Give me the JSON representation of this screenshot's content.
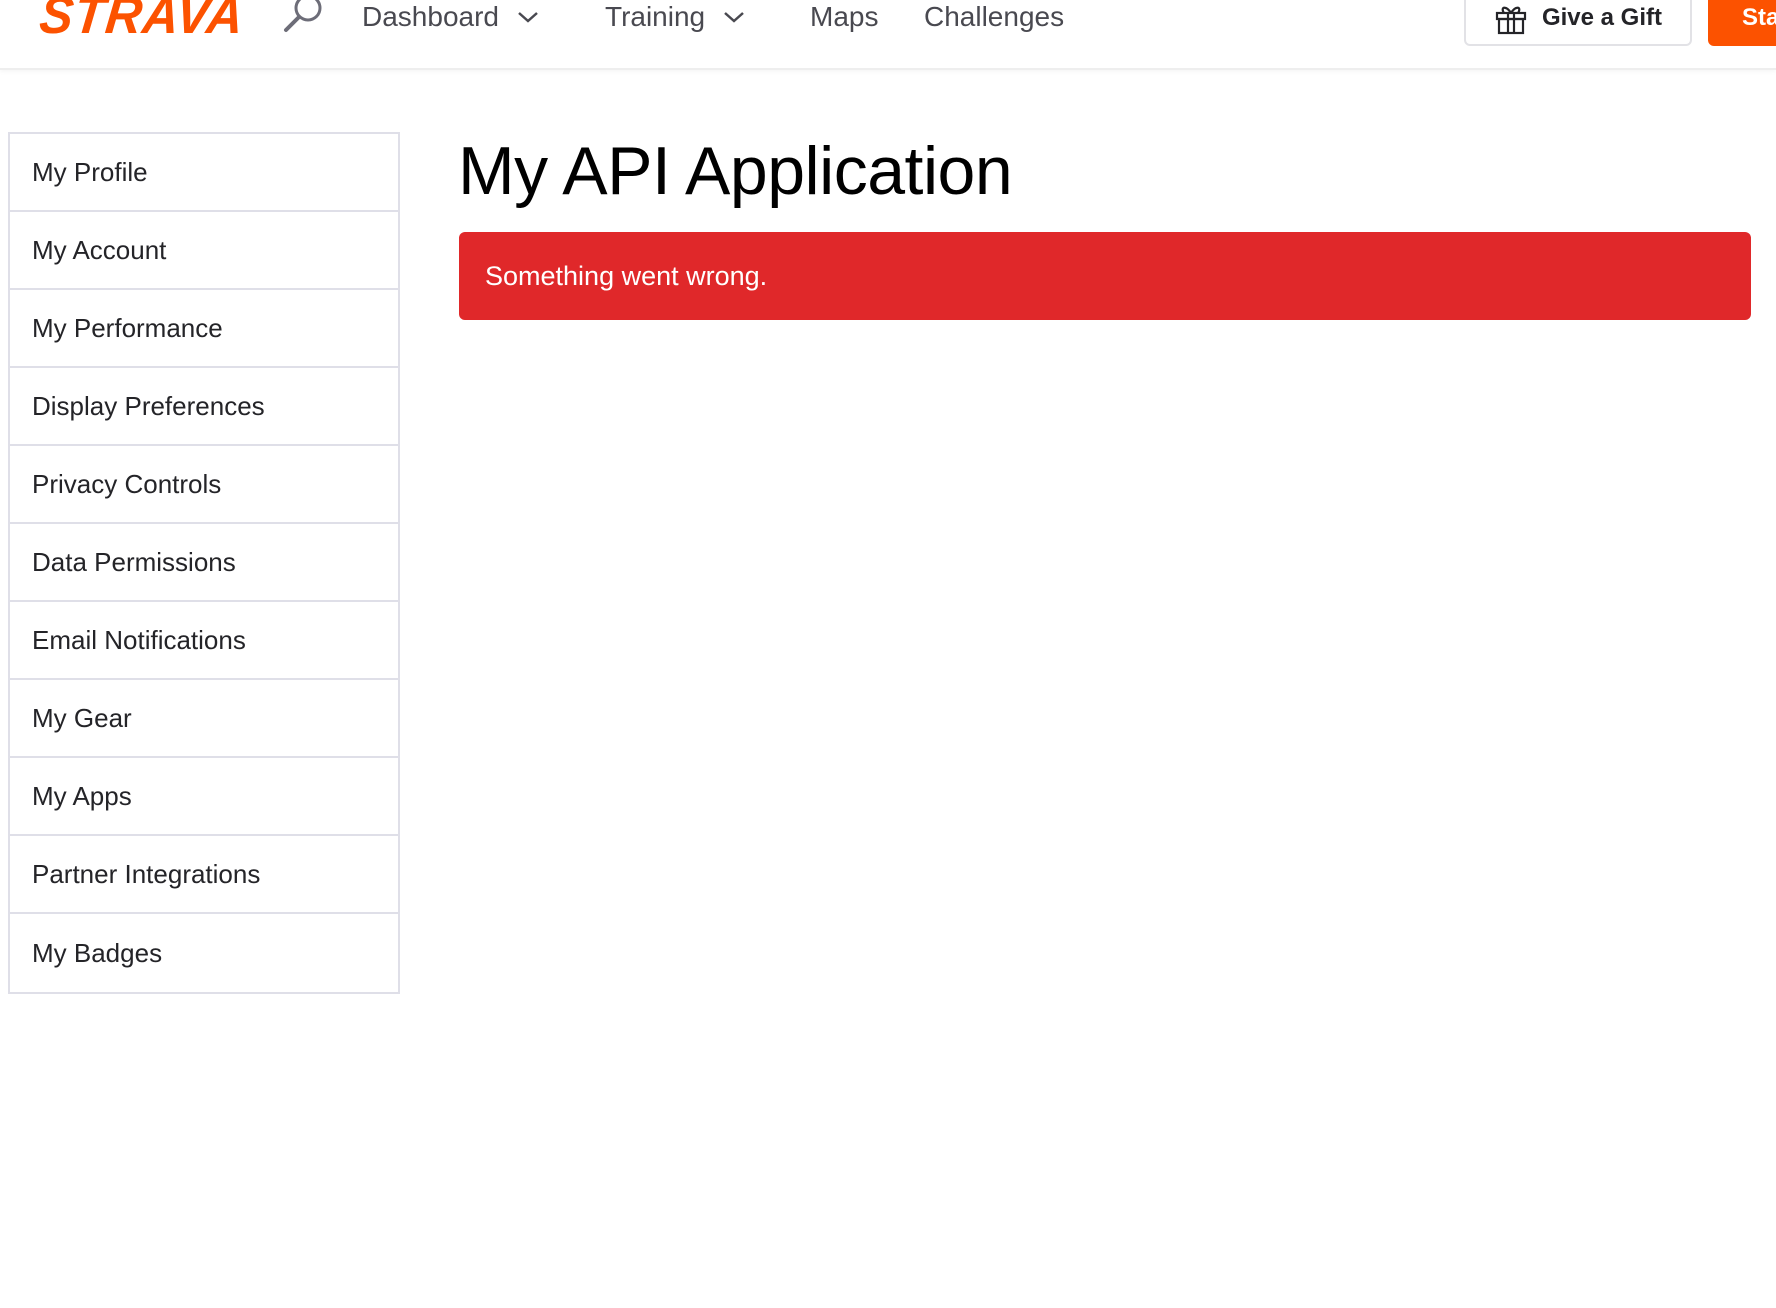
{
  "header": {
    "logo_text": "STRAVA",
    "brand_color": "#fc5200",
    "search_icon": "search-icon",
    "nav": [
      {
        "label": "Dashboard",
        "has_dropdown": true
      },
      {
        "label": "Training",
        "has_dropdown": true
      },
      {
        "label": "Maps",
        "has_dropdown": false
      },
      {
        "label": "Challenges",
        "has_dropdown": false
      }
    ],
    "gift_button": {
      "label": "Give a Gift",
      "icon": "gift-icon"
    },
    "start_button": {
      "label": "Sta"
    }
  },
  "sidebar": {
    "items": [
      {
        "label": "My Profile"
      },
      {
        "label": "My Account"
      },
      {
        "label": "My Performance"
      },
      {
        "label": "Display Preferences"
      },
      {
        "label": "Privacy Controls"
      },
      {
        "label": "Data Permissions"
      },
      {
        "label": "Email Notifications"
      },
      {
        "label": "My Gear"
      },
      {
        "label": "My Apps"
      },
      {
        "label": "Partner Integrations"
      },
      {
        "label": "My Badges"
      }
    ]
  },
  "main": {
    "title": "My API Application",
    "alert": {
      "message": "Something went wrong.",
      "color": "#e0282a"
    }
  }
}
